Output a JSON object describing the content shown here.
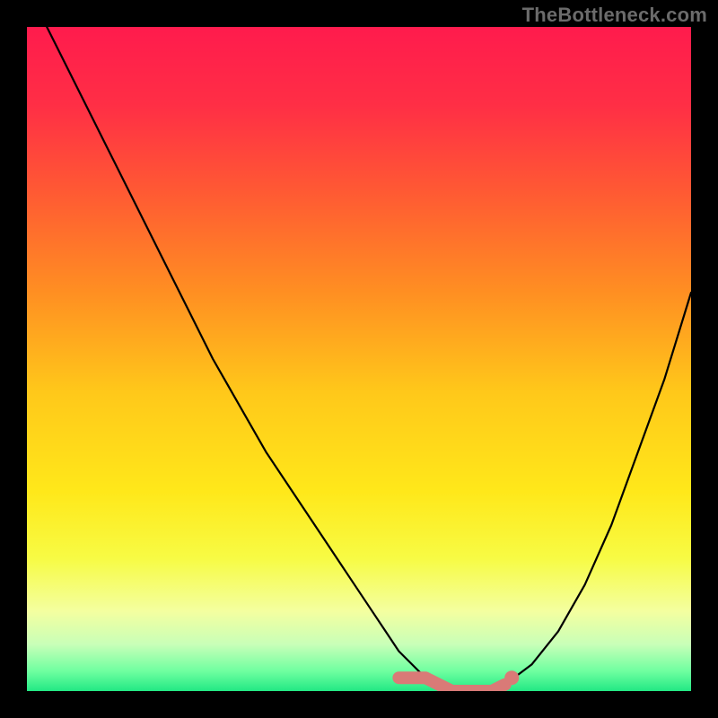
{
  "attribution": "TheBottleneck.com",
  "colors": {
    "frame": "#000000",
    "gradient_stops": [
      {
        "offset": 0.0,
        "color": "#ff1b4d"
      },
      {
        "offset": 0.12,
        "color": "#ff2f45"
      },
      {
        "offset": 0.25,
        "color": "#ff5a33"
      },
      {
        "offset": 0.4,
        "color": "#ff8f22"
      },
      {
        "offset": 0.55,
        "color": "#ffc81a"
      },
      {
        "offset": 0.7,
        "color": "#ffe81a"
      },
      {
        "offset": 0.8,
        "color": "#f7fb44"
      },
      {
        "offset": 0.88,
        "color": "#f4ffa0"
      },
      {
        "offset": 0.93,
        "color": "#c8ffb8"
      },
      {
        "offset": 0.97,
        "color": "#6fffa0"
      },
      {
        "offset": 1.0,
        "color": "#22e884"
      }
    ],
    "curve": "#000000",
    "pink": "#d97a77"
  },
  "chart_data": {
    "type": "line",
    "title": "",
    "xlabel": "",
    "ylabel": "",
    "xlim": [
      0,
      100
    ],
    "ylim": [
      0,
      100
    ],
    "series": [
      {
        "name": "bottleneck-curve",
        "x": [
          0,
          4,
          8,
          12,
          16,
          20,
          24,
          28,
          32,
          36,
          40,
          44,
          48,
          52,
          54,
          56,
          58,
          60,
          62,
          64,
          66,
          68,
          70,
          72,
          76,
          80,
          84,
          88,
          92,
          96,
          100
        ],
        "y": [
          106,
          98,
          90,
          82,
          74,
          66,
          58,
          50,
          43,
          36,
          30,
          24,
          18,
          12,
          9,
          6,
          4,
          2,
          1,
          0,
          0,
          0,
          0,
          1,
          4,
          9,
          16,
          25,
          36,
          47,
          60
        ]
      }
    ],
    "annotations": {
      "flat_bottom_range_x": [
        56,
        73
      ],
      "pink_dot_x": 73,
      "pink_dot_y": 2
    }
  }
}
